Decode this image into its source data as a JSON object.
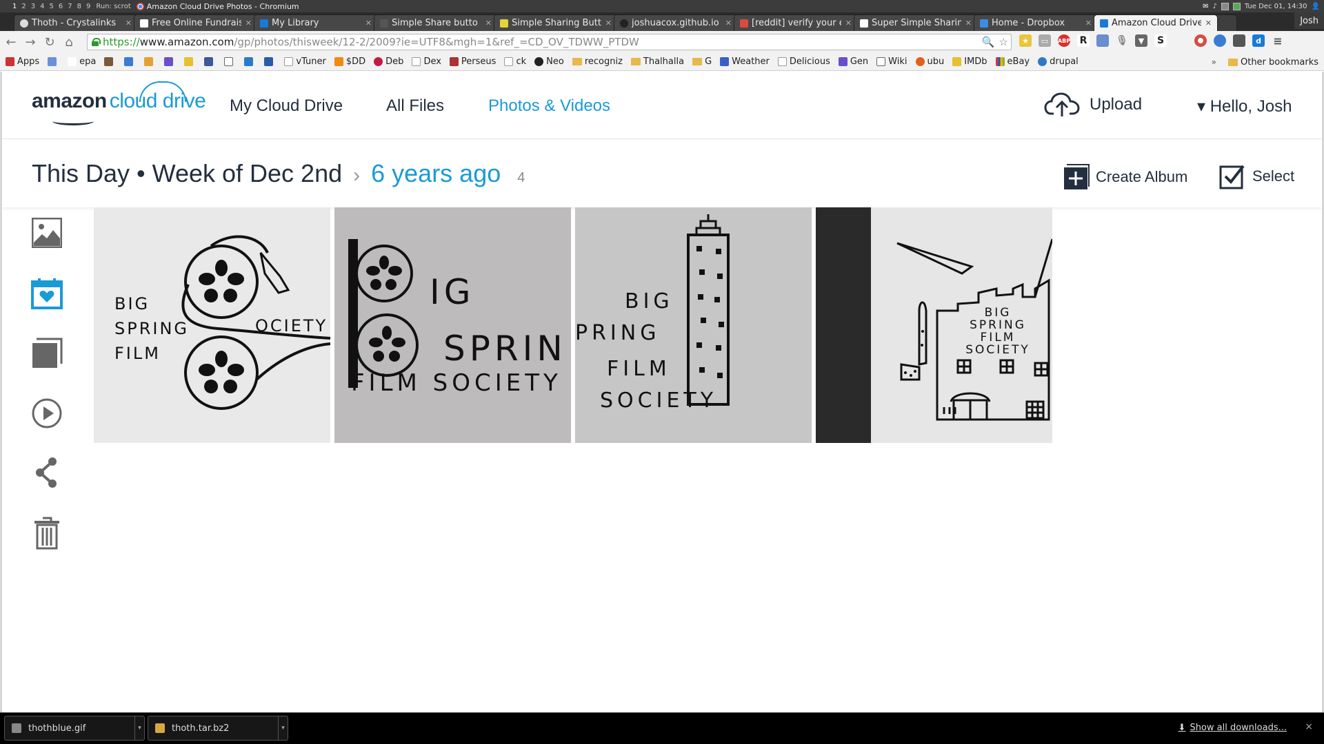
{
  "os_panel": {
    "workspaces": [
      "1",
      "2",
      "3",
      "4",
      "5",
      "6",
      "7",
      "8",
      "9"
    ],
    "run_text": "Run: scrot",
    "window_title": "Amazon Cloud Drive Photos - Chromium",
    "clock": "Tue Dec 01, 14:30"
  },
  "tabs": [
    {
      "title": "Thoth - Crystalinks",
      "active": false
    },
    {
      "title": "Free Online Fundrais",
      "active": false
    },
    {
      "title": "My Library",
      "active": false
    },
    {
      "title": "Simple Share butto",
      "active": false
    },
    {
      "title": "Simple Sharing Butt",
      "active": false
    },
    {
      "title": "joshuacox.github.io",
      "active": false
    },
    {
      "title": "[reddit] verify your e",
      "active": false
    },
    {
      "title": "Super Simple Sharin",
      "active": false
    },
    {
      "title": "Home - Dropbox",
      "active": false
    },
    {
      "title": "Amazon Cloud Drive",
      "active": true
    }
  ],
  "profile_name": "Josh",
  "address_bar": {
    "scheme": "https://",
    "host": "www.amazon.com",
    "path": "/gp/photos/thisweek/12-2/2009?ie=UTF8&mgh=1&ref_=CD_OV_TDWW_PTDW"
  },
  "bookmarks": [
    "Apps",
    "",
    "epa",
    "",
    "",
    "",
    "",
    "",
    "",
    "",
    "",
    "",
    "vTuner",
    "$DD",
    "Deb",
    "Dex",
    "Perseus",
    "ck",
    "Neo",
    "recogniz",
    "Thalhalla",
    "G",
    "Weather",
    "Delicious",
    "Gen",
    "Wiki",
    "ubu",
    "IMDb",
    "eBay",
    "drupal"
  ],
  "bookmarks_overflow": "»",
  "other_bookmarks": "Other bookmarks",
  "site": {
    "logo_brand": "amazon",
    "logo_product": "cloud drive",
    "nav": [
      "My Cloud Drive",
      "All Files",
      "Photos & Videos"
    ],
    "active_nav": "Photos & Videos",
    "upload_label": "Upload",
    "account_label": "▾ Hello, Josh",
    "breadcrumb_main": "This Day • Week of Dec 2nd",
    "breadcrumb_sub": "6 years ago",
    "item_count": "4",
    "create_album_label": "Create Album",
    "select_label": "Select",
    "accent_color": "#1a9ad6",
    "sidebar_icons": [
      "image-icon",
      "calendar-heart-icon",
      "albums-icon",
      "video-play-icon",
      "share-icon",
      "trash-icon"
    ],
    "photos": [
      {
        "lines": [
          "BIG",
          "SPRING",
          "FILM",
          "OCIETY"
        ]
      },
      {
        "lines": [
          "IG",
          "SPRIN",
          "FILM SOCIETY"
        ]
      },
      {
        "lines": [
          "BIG",
          "PRING",
          "FILM",
          "SOCIETY"
        ]
      },
      {
        "lines": [
          "BIG",
          "SPRING",
          "FILM",
          "SOCIETY"
        ]
      }
    ]
  },
  "downloads": {
    "items": [
      "thothblue.gif",
      "thoth.tar.bz2"
    ],
    "show_all": "Show all downloads...",
    "close": "×"
  }
}
